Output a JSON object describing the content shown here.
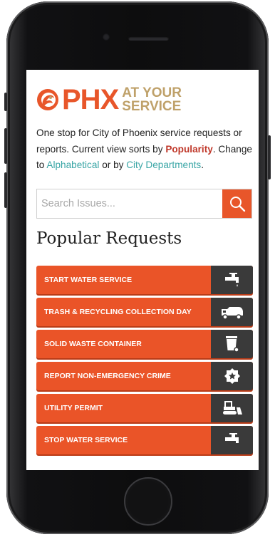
{
  "header": {
    "logo_main": "PHX",
    "logo_tag_line1": "AT YOUR",
    "logo_tag_line2": "SERVICE",
    "logo_icon": "phoenix-bird-icon"
  },
  "intro": {
    "text1": "One stop for City of Phoenix service requests or reports. Current view sorts by ",
    "popularity": "Popularity",
    "text2": ". Change to ",
    "alphabetical": "Alphabetical",
    "text3": " or by ",
    "departments": "City Departments",
    "text4": "."
  },
  "search": {
    "placeholder": "Search Issues...",
    "button_icon": "search-icon"
  },
  "section_title": "Popular Requests",
  "requests": [
    {
      "label": "START WATER SERVICE",
      "icon": "faucet-icon"
    },
    {
      "label": "TRASH & RECYCLING COLLECTION DAY",
      "icon": "garbage-truck-icon"
    },
    {
      "label": "SOLID WASTE CONTAINER",
      "icon": "trash-bin-icon"
    },
    {
      "label": "REPORT NON-EMERGENCY CRIME",
      "icon": "police-badge-icon"
    },
    {
      "label": "UTILITY PERMIT",
      "icon": "bulldozer-icon"
    },
    {
      "label": "STOP WATER SERVICE",
      "icon": "faucet-icon"
    }
  ],
  "colors": {
    "accent": "#ea5428",
    "icon_bg": "#3a3a3a",
    "logo_gold": "#bfa16a",
    "link": "#3aa6a6",
    "popularity": "#c0392b"
  }
}
